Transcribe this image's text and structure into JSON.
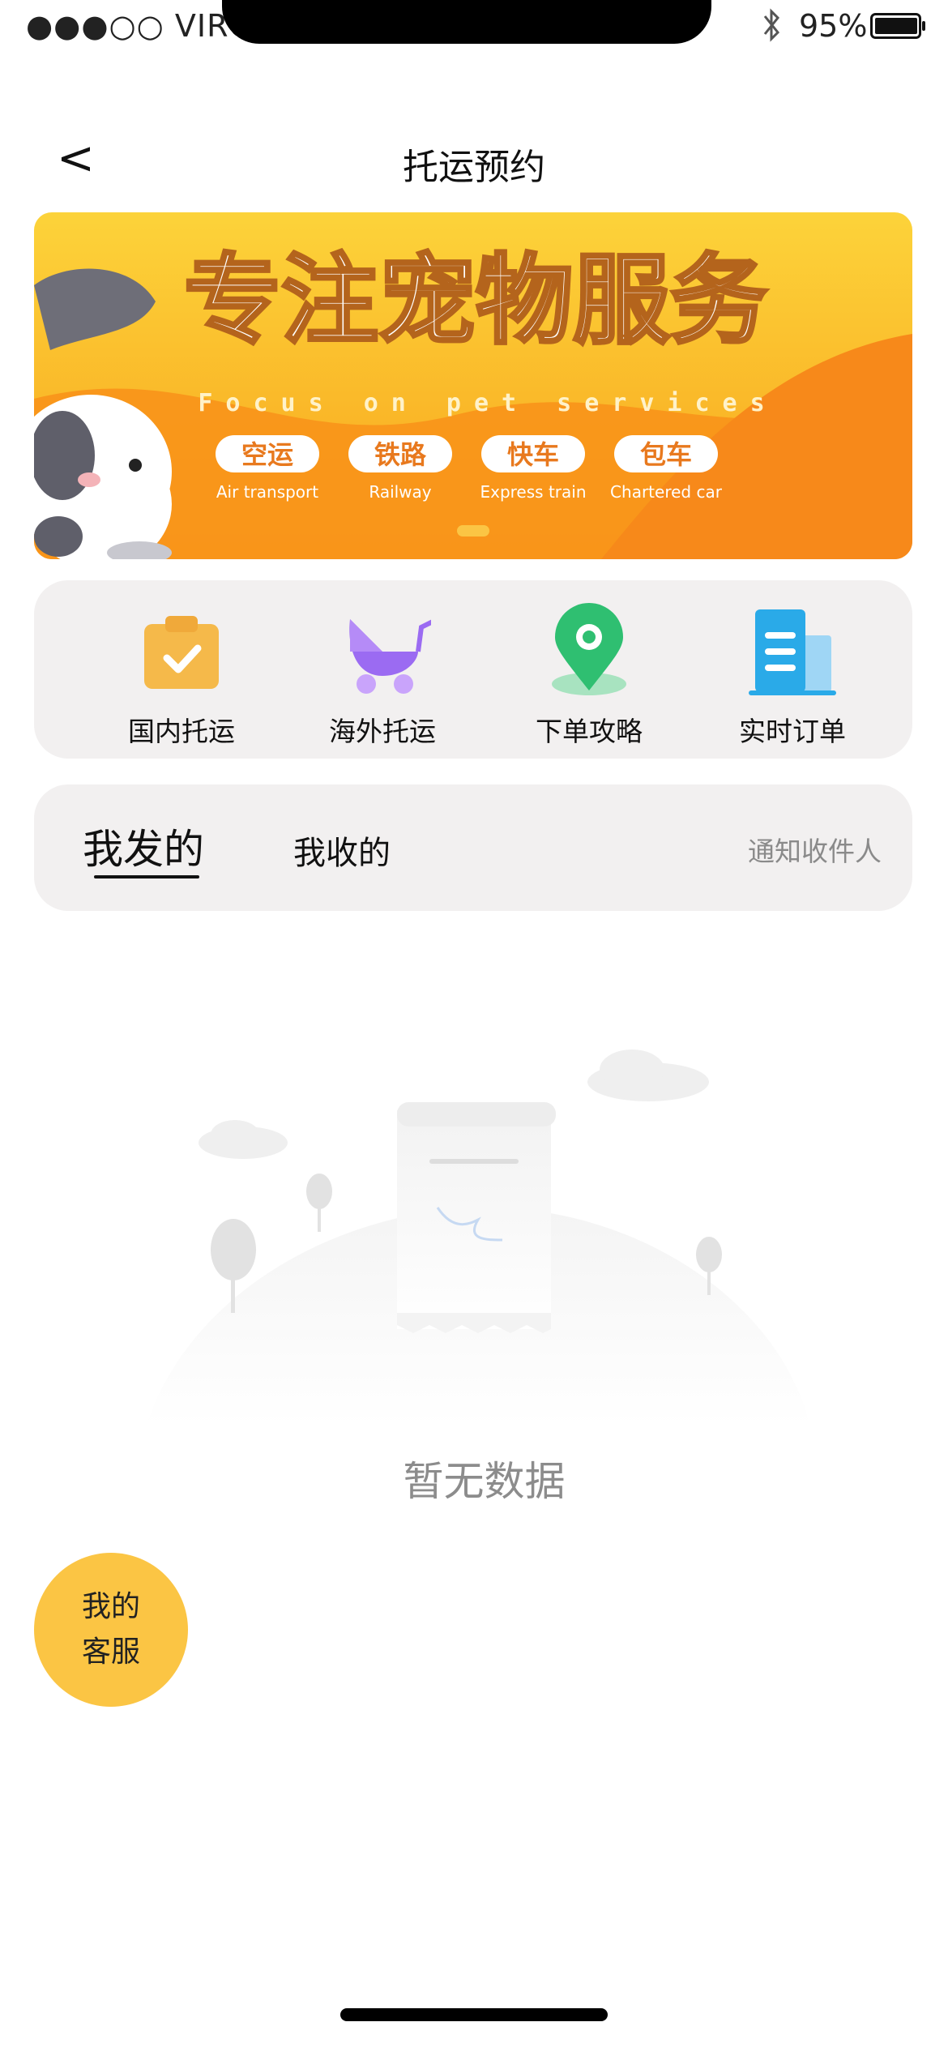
{
  "status_bar": {
    "signal": "●●●○○",
    "carrier": "VIRGIN",
    "battery_percent": "95%"
  },
  "nav": {
    "back_symbol": "<",
    "title": "托运预约"
  },
  "banner": {
    "headline": "专注宠物服务",
    "subtitle_en": "Focus on pet services",
    "tags": [
      {
        "cn": "空运",
        "en": "Air transport"
      },
      {
        "cn": "铁路",
        "en": "Railway"
      },
      {
        "cn": "快车",
        "en": "Express train"
      },
      {
        "cn": "包车",
        "en": "Chartered car"
      }
    ],
    "colors": {
      "background": "#f9a825",
      "wave": "#f7931e",
      "pill": "#ffffff",
      "pill_text": "#e8791e"
    }
  },
  "quick_menu": [
    {
      "label": "国内托运",
      "icon": "clipboard-check-icon",
      "color": "#f5b94a"
    },
    {
      "label": "海外托运",
      "icon": "baby-stroller-icon",
      "color": "#9b6bf2"
    },
    {
      "label": "下单攻略",
      "icon": "map-pin-icon",
      "color": "#2fbf71"
    },
    {
      "label": "实时订单",
      "icon": "building-icon",
      "color": "#2aaae8"
    }
  ],
  "tabs": {
    "sent": "我发的",
    "received": "我收的",
    "notify": "通知收件人"
  },
  "empty_state": {
    "text": "暂无数据",
    "illustration": "empty-scroll-illustration"
  },
  "service_button": {
    "line1": "我的",
    "line2": "客服",
    "color": "#fbc544"
  }
}
